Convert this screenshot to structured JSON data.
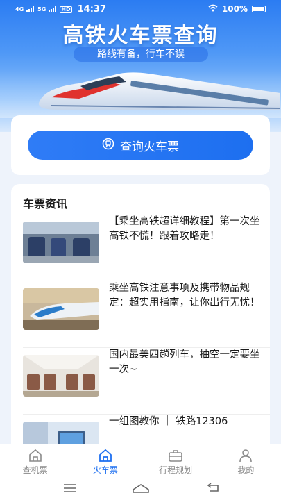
{
  "status": {
    "net1": "4G",
    "net2": "5G",
    "hd": "HD",
    "time": "14:37",
    "battery": "100%"
  },
  "hero": {
    "title": "高铁火车票查询",
    "subtitle": "路线有备，行车不误"
  },
  "query": {
    "label": "查询火车票",
    "icon": "train-icon"
  },
  "news": {
    "heading": "车票资讯",
    "items": [
      {
        "text": "【乘坐高铁超详细教程】第一次坐高铁不慌！跟着攻略走！",
        "thumb": "train-interior"
      },
      {
        "text": "乘坐高铁注意事项及携带物品规定：超实用指南，让你出行无忧！",
        "thumb": "bullet-train"
      },
      {
        "text": "国内最美四趟列车，抽空一定要坐一次~",
        "thumb": "sleeper-cabin"
      },
      {
        "text": "一组图教你 ｜ 铁路12306",
        "thumb": "laptop-seat"
      }
    ]
  },
  "tabs": [
    {
      "label": "查机票",
      "icon": "home-icon",
      "active": false
    },
    {
      "label": "火车票",
      "icon": "home-icon",
      "active": true
    },
    {
      "label": "行程规划",
      "icon": "briefcase-icon",
      "active": false
    },
    {
      "label": "我的",
      "icon": "person-icon",
      "active": false
    }
  ],
  "colors": {
    "accent": "#1d6ff0",
    "inactive": "#8a8a8a"
  }
}
